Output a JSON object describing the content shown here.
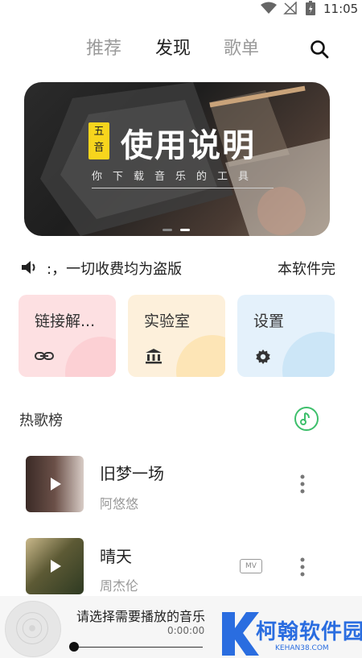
{
  "status_bar": {
    "time": "11:05"
  },
  "tabs": [
    {
      "label": "推荐",
      "active": false
    },
    {
      "label": "发现",
      "active": true
    },
    {
      "label": "歌单",
      "active": false
    }
  ],
  "banner": {
    "badge_line1": "五",
    "badge_line2": "音",
    "title": "使用说明",
    "subtitle": "你下载音乐的工具",
    "page_count": 2,
    "active_page": 2
  },
  "notice": {
    "text": ":，一切收费均为盗版",
    "text_next": "本软件完"
  },
  "cards": [
    {
      "title": "链接解...",
      "icon": "link-icon",
      "color": "#fde0e2"
    },
    {
      "title": "实验室",
      "icon": "bank-icon",
      "color": "#fdf0db"
    },
    {
      "title": "设置",
      "icon": "gear-icon",
      "color": "#e4f1fb"
    }
  ],
  "hot_list": {
    "title": "热歌榜",
    "songs": [
      {
        "title": "旧梦一场",
        "artist": "阿悠悠",
        "has_mv": false
      },
      {
        "title": "晴天",
        "artist": "周杰伦",
        "has_mv": true,
        "mv_label": "MV"
      }
    ]
  },
  "player": {
    "title": "请选择需要播放的音乐",
    "time": "0:00:00",
    "progress": 0
  },
  "watermark": {
    "text": "柯翰软件园",
    "url": "KEHAN38.COM"
  },
  "colors": {
    "accent_green": "#3dbf6b",
    "watermark_blue": "#2a6de0"
  }
}
